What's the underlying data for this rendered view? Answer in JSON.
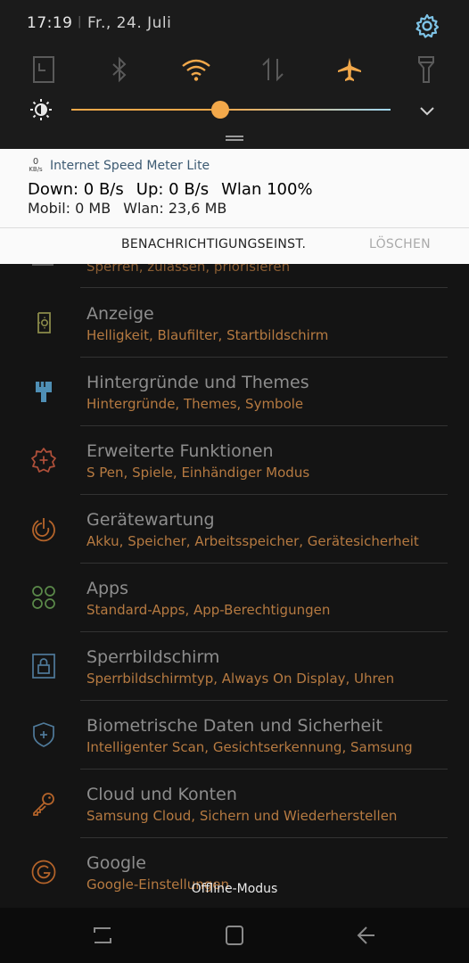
{
  "status": {
    "time": "17:19",
    "separator": "|",
    "date": "Fr., 24. Juli"
  },
  "quick_toggles": [
    {
      "name": "screenshot-icon",
      "state": "off"
    },
    {
      "name": "bluetooth-icon",
      "state": "off"
    },
    {
      "name": "wifi-icon",
      "state": "on"
    },
    {
      "name": "mobile-data-icon",
      "state": "off"
    },
    {
      "name": "airplane-mode-icon",
      "state": "on"
    },
    {
      "name": "flashlight-icon",
      "state": "off"
    }
  ],
  "brightness": {
    "level": 0.47
  },
  "colors": {
    "accent": "#f2a84a",
    "inactive": "#5a5a5a",
    "link": "#7ec3e6",
    "subtitle": "#b67a41"
  },
  "notification": {
    "icon_value": "0",
    "icon_unit": "KB/s",
    "app": "Internet Speed Meter Lite",
    "down": "Down: 0 B/s",
    "up": "Up: 0 B/s",
    "wlan_pct": "Wlan 100%",
    "mobil": "Mobil: 0 MB",
    "wlan": "Wlan: 23,6 MB",
    "action_settings": "BENACHRICHTIGUNGSEINST.",
    "action_clear": "LÖSCHEN"
  },
  "settings": {
    "partial_sub": "Sperren, zulassen, priorisieren",
    "items": [
      {
        "title": "Anzeige",
        "sub": "Helligkeit, Blaufilter, Startbildschirm"
      },
      {
        "title": "Hintergründe und Themes",
        "sub": "Hintergründe, Themes, Symbole"
      },
      {
        "title": "Erweiterte Funktionen",
        "sub": "S Pen, Spiele, Einhändiger Modus"
      },
      {
        "title": "Gerätewartung",
        "sub": "Akku, Speicher, Arbeitsspeicher, Gerätesicherheit"
      },
      {
        "title": "Apps",
        "sub": "Standard-Apps, App-Berechtigungen"
      },
      {
        "title": "Sperrbildschirm",
        "sub": "Sperrbildschirmtyp, Always On Display, Uhren"
      },
      {
        "title": "Biometrische Daten und Sicherheit",
        "sub": "Intelligenter Scan, Gesichtserkennung, Samsung"
      },
      {
        "title": "Cloud und Konten",
        "sub": "Samsung Cloud, Sichern und Wiederherstellen"
      },
      {
        "title": "Google",
        "sub": "Google-Einstellungen"
      }
    ]
  },
  "toast": "Offline-Modus"
}
